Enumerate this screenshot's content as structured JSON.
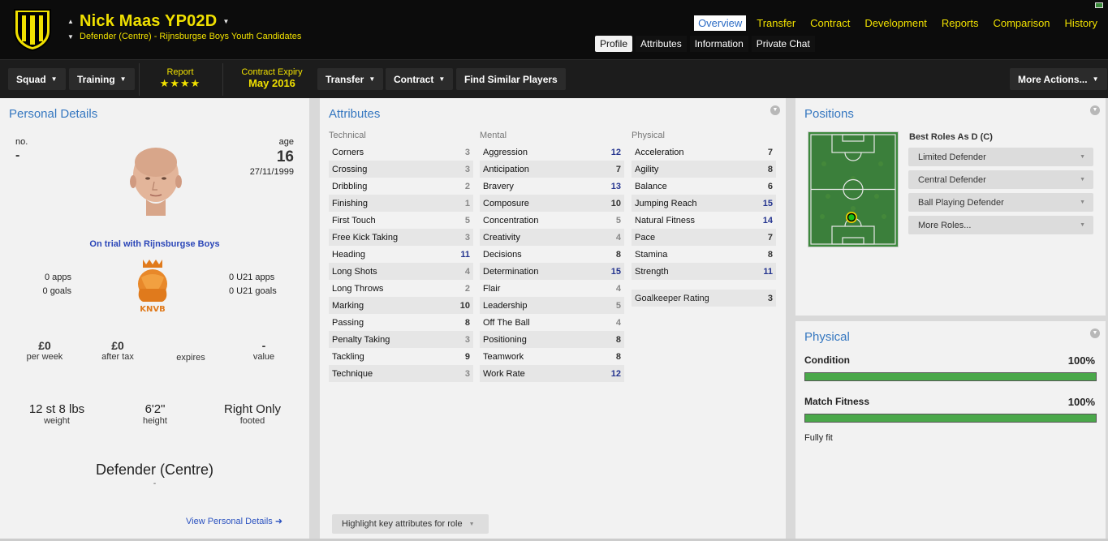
{
  "header": {
    "name": "Nick Maas YP02D",
    "subtitle": "Defender (Centre) - Rijnsburgse Boys Youth Candidates",
    "main_tabs": [
      "Overview",
      "Transfer",
      "Contract",
      "Development",
      "Reports",
      "Comparison",
      "History"
    ],
    "sub_tabs": [
      "Profile",
      "Attributes",
      "Information",
      "Private Chat"
    ],
    "active_main_tab": "Overview",
    "active_sub_tab": "Profile",
    "accent_color": "#f0e000"
  },
  "toolbar": {
    "squad": "Squad",
    "training": "Training",
    "report_label": "Report",
    "report_stars": "★★★★",
    "contract_expiry_label": "Contract Expiry",
    "contract_expiry_value": "May 2016",
    "transfer": "Transfer",
    "contract": "Contract",
    "find_similar": "Find Similar Players",
    "more_actions": "More Actions..."
  },
  "personal": {
    "title": "Personal Details",
    "no_label": "no.",
    "no_value": "-",
    "age_label": "age",
    "age_value": "16",
    "dob": "27/11/1999",
    "trial": "On trial with Rijnsburgse Boys",
    "apps": "0 apps",
    "goals": "0 goals",
    "u21_apps": "0 U21 apps",
    "u21_goals": "0 U21 goals",
    "knvb_text": "KNVB",
    "wage_value": "£0",
    "wage_label": "per week",
    "after_tax_value": "£0",
    "after_tax_label": "after tax",
    "expires_value": "",
    "expires_label": "expires",
    "value_value": "-",
    "value_label": "value",
    "weight_value": "12 st 8 lbs",
    "weight_label": "weight",
    "height_value": "6'2\"",
    "height_label": "height",
    "foot_value": "Right Only",
    "foot_label": "footed",
    "position": "Defender (Centre)",
    "position_dash": "-",
    "view_link": "View Personal Details ➜"
  },
  "attributes": {
    "title": "Attributes",
    "technical_title": "Technical",
    "mental_title": "Mental",
    "physical_title": "Physical",
    "technical": [
      {
        "name": "Corners",
        "value": "3"
      },
      {
        "name": "Crossing",
        "value": "3"
      },
      {
        "name": "Dribbling",
        "value": "2"
      },
      {
        "name": "Finishing",
        "value": "1"
      },
      {
        "name": "First Touch",
        "value": "5"
      },
      {
        "name": "Free Kick Taking",
        "value": "3"
      },
      {
        "name": "Heading",
        "value": "11"
      },
      {
        "name": "Long Shots",
        "value": "4"
      },
      {
        "name": "Long Throws",
        "value": "2"
      },
      {
        "name": "Marking",
        "value": "10"
      },
      {
        "name": "Passing",
        "value": "8"
      },
      {
        "name": "Penalty Taking",
        "value": "3"
      },
      {
        "name": "Tackling",
        "value": "9"
      },
      {
        "name": "Technique",
        "value": "3"
      }
    ],
    "mental": [
      {
        "name": "Aggression",
        "value": "12"
      },
      {
        "name": "Anticipation",
        "value": "7"
      },
      {
        "name": "Bravery",
        "value": "13"
      },
      {
        "name": "Composure",
        "value": "10"
      },
      {
        "name": "Concentration",
        "value": "5"
      },
      {
        "name": "Creativity",
        "value": "4"
      },
      {
        "name": "Decisions",
        "value": "8"
      },
      {
        "name": "Determination",
        "value": "15"
      },
      {
        "name": "Flair",
        "value": "4"
      },
      {
        "name": "Leadership",
        "value": "5"
      },
      {
        "name": "Off The Ball",
        "value": "4"
      },
      {
        "name": "Positioning",
        "value": "8"
      },
      {
        "name": "Teamwork",
        "value": "8"
      },
      {
        "name": "Work Rate",
        "value": "12"
      }
    ],
    "physical": [
      {
        "name": "Acceleration",
        "value": "7"
      },
      {
        "name": "Agility",
        "value": "8"
      },
      {
        "name": "Balance",
        "value": "6"
      },
      {
        "name": "Jumping Reach",
        "value": "15"
      },
      {
        "name": "Natural Fitness",
        "value": "14"
      },
      {
        "name": "Pace",
        "value": "7"
      },
      {
        "name": "Stamina",
        "value": "8"
      },
      {
        "name": "Strength",
        "value": "11"
      }
    ],
    "gk_label": "Goalkeeper Rating",
    "gk_value": "3",
    "highlight_button": "Highlight key attributes for role"
  },
  "positions": {
    "title": "Positions",
    "best_roles_title": "Best Roles As D (C)",
    "roles": [
      "Limited Defender",
      "Central Defender",
      "Ball Playing Defender",
      "More Roles..."
    ]
  },
  "physical_panel": {
    "title": "Physical",
    "condition_label": "Condition",
    "condition_value": "100%",
    "condition_level": 1.0,
    "fitness_label": "Match Fitness",
    "fitness_value": "100%",
    "fitness_level": 1.0,
    "fit_text": "Fully fit"
  },
  "icons": {
    "collapse": "chevron-down-icon",
    "crest": "club-crest-icon",
    "flag": "flag-icon",
    "knvb": "knvb-lion-logo"
  }
}
